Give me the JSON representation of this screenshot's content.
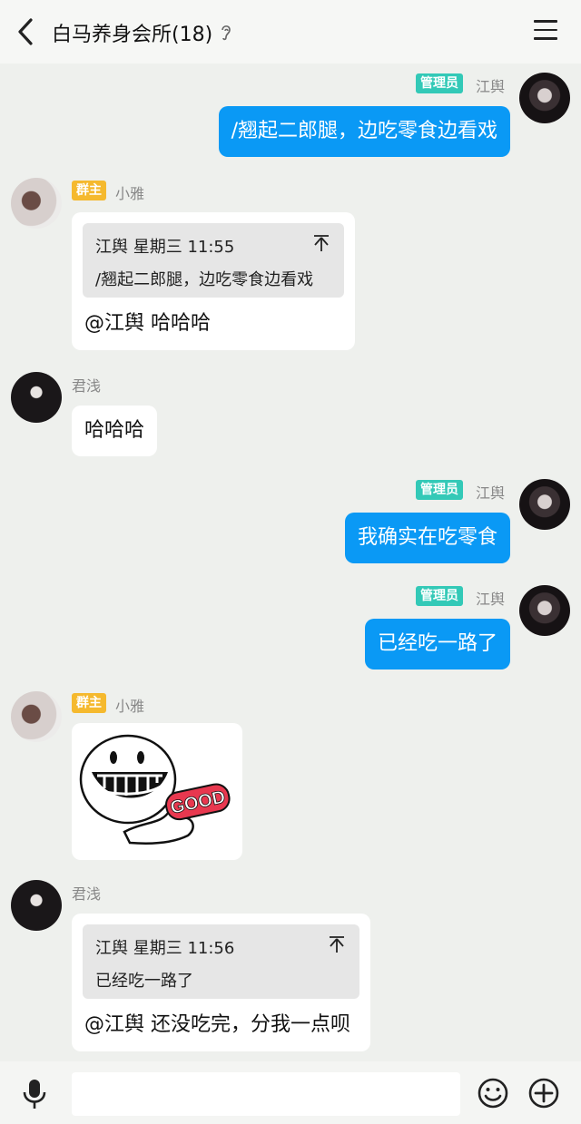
{
  "header": {
    "title": "白马养身会所(18)"
  },
  "messages": [
    {
      "tag": "管理员",
      "nick": "江舆",
      "text": "/翘起二郎腿，边吃零食边看戏"
    },
    {
      "tag": "群主",
      "nick": "小雅",
      "quote_header": "江舆 星期三 11:55",
      "quote_text": "/翘起二郎腿，边吃零食边看戏",
      "text": "@江舆 哈哈哈"
    },
    {
      "nick": "君浅",
      "text": "哈哈哈"
    },
    {
      "tag": "管理员",
      "nick": "江舆",
      "text": "我确实在吃零食"
    },
    {
      "tag": "管理员",
      "nick": "江舆",
      "text": "已经吃一路了"
    },
    {
      "tag": "群主",
      "nick": "小雅",
      "sticker_label": "GOOD"
    },
    {
      "nick": "君浅",
      "quote_header": "江舆 星期三 11:56",
      "quote_text": "已经吃一路了",
      "text": "@江舆 还没吃完，分我一点呗"
    }
  ],
  "input": {
    "placeholder": ""
  }
}
